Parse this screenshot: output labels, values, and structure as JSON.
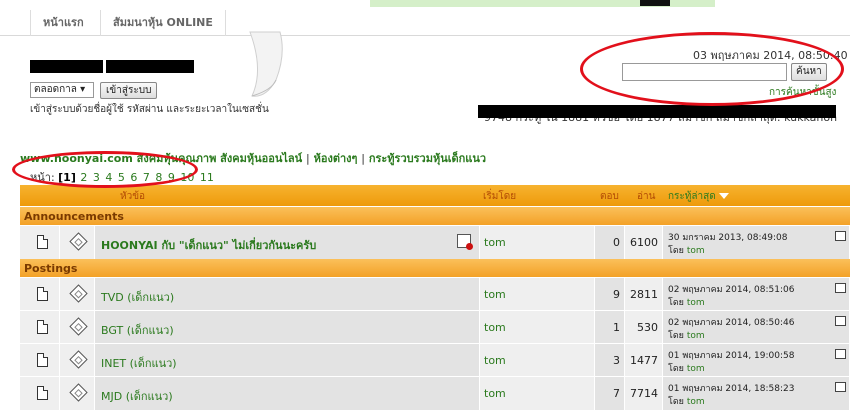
{
  "nav": {
    "tabs": [
      "หน้าแรก",
      "สัมมนาหุ้น ONLINE"
    ]
  },
  "login": {
    "duration_label": "ตลอดกาล",
    "login_button": "เข้าสู่ระบบ",
    "note": "เข้าสู่ระบบด้วยชื่อผู้ใช้ รหัสผ่าน และระยะเวลาในเซสชั่น"
  },
  "header": {
    "date": "03 พฤษภาคม 2014, 08:50:40",
    "search_button": "ค้นหา",
    "advanced_search": "การค้นหาขั้นสูง",
    "stats_text": "9748 กระทู้ ใน 1881 หัวข้อ  โดย 1877 สมาชิก  สมาชิกล่าสุด: kukkanon"
  },
  "breadcrumb": {
    "items": [
      "www.hoonyai.com สังคมหุ้นคุณภาพ สังคมหุ้นออนไลน์",
      "ห้องต่างๆ",
      "กระทู้รวบรวมหุ้นเด็กแนว"
    ],
    "separator": "|"
  },
  "pagination": {
    "label": "หน้า:",
    "current": "[1]",
    "pages": [
      "2",
      "3",
      "4",
      "5",
      "6",
      "7",
      "8",
      "9",
      "10",
      "11"
    ]
  },
  "table": {
    "headers": {
      "topic": "หัวข้อ",
      "started_by": "เริ่มโดย",
      "replies": "ตอบ",
      "views": "อ่าน",
      "last_post": "กระทู้ล่าสุด"
    },
    "sections": [
      {
        "name": "Announcements",
        "rows": [
          {
            "title": "HOONYAI กับ \"เด็กแนว\" ไม่เกี่ยวกันนะครับ",
            "starter": "tom",
            "replies": "0",
            "views": "6100",
            "last_date": "30 มกราคม 2013, 08:49:08",
            "last_by_label": "โดย",
            "last_by": "tom"
          }
        ]
      },
      {
        "name": "Postings",
        "rows": [
          {
            "title": "TVD (เด็กแนว)",
            "starter": "tom",
            "replies": "9",
            "views": "2811",
            "last_date": "02 พฤษภาคม 2014, 08:51:06",
            "last_by_label": "โดย",
            "last_by": "tom"
          },
          {
            "title": "BGT (เด็กแนว)",
            "starter": "tom",
            "replies": "1",
            "views": "530",
            "last_date": "02 พฤษภาคม 2014, 08:50:46",
            "last_by_label": "โดย",
            "last_by": "tom"
          },
          {
            "title": "INET (เด็กแนว)",
            "starter": "tom",
            "replies": "3",
            "views": "1477",
            "last_date": "01 พฤษภาคม 2014, 19:00:58",
            "last_by_label": "โดย",
            "last_by": "tom"
          },
          {
            "title": "MJD (เด็กแนว)",
            "starter": "tom",
            "replies": "7",
            "views": "7714",
            "last_date": "01 พฤษภาคม 2014, 18:58:23",
            "last_by_label": "โดย",
            "last_by": "tom"
          }
        ]
      }
    ]
  },
  "colors": {
    "link": "#2b7a1e",
    "header_orange": "#f0a020",
    "annotation_red": "#e2101b"
  }
}
